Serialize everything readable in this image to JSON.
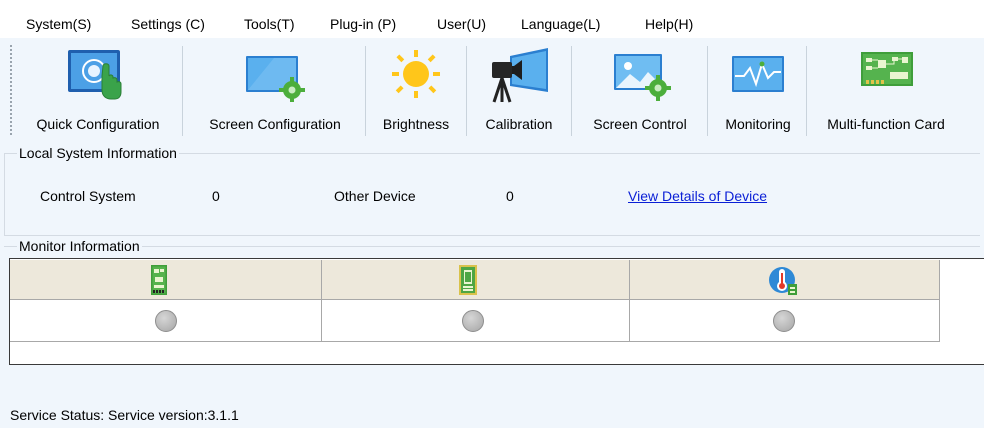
{
  "menu": {
    "items": [
      "System(S)",
      "Settings (C)",
      "Tools(T)",
      "Plug-in (P)",
      "User(U)",
      "Language(L)",
      "Help(H)"
    ]
  },
  "toolbar": {
    "items": [
      {
        "label": "Quick Configuration",
        "icon": "quick-config-icon"
      },
      {
        "label": "Screen Configuration",
        "icon": "screen-config-icon"
      },
      {
        "label": "Brightness",
        "icon": "brightness-icon"
      },
      {
        "label": "Calibration",
        "icon": "calibration-icon"
      },
      {
        "label": "Screen Control",
        "icon": "screen-control-icon"
      },
      {
        "label": "Monitoring",
        "icon": "monitoring-icon"
      },
      {
        "label": "Multi-function Card",
        "icon": "multifunction-card-icon"
      }
    ]
  },
  "local_system": {
    "title": "Local System Information",
    "control_system_label": "Control System",
    "control_system_value": "0",
    "other_device_label": "Other Device",
    "other_device_value": "0",
    "view_details_link": "View Details of Device"
  },
  "monitor": {
    "title": "Monitor Information",
    "columns": [
      {
        "icon": "receiving-card-icon",
        "status": "unknown"
      },
      {
        "icon": "module-card-icon",
        "status": "unknown"
      },
      {
        "icon": "temperature-icon",
        "status": "unknown"
      }
    ]
  },
  "status_bar": {
    "text": "Service Status:  Service version:3.1.1"
  },
  "colors": {
    "background": "#f0f6fc",
    "link": "#0a1fd6",
    "table_header": "#ede8db",
    "status_unknown": "#bdbdbd"
  }
}
